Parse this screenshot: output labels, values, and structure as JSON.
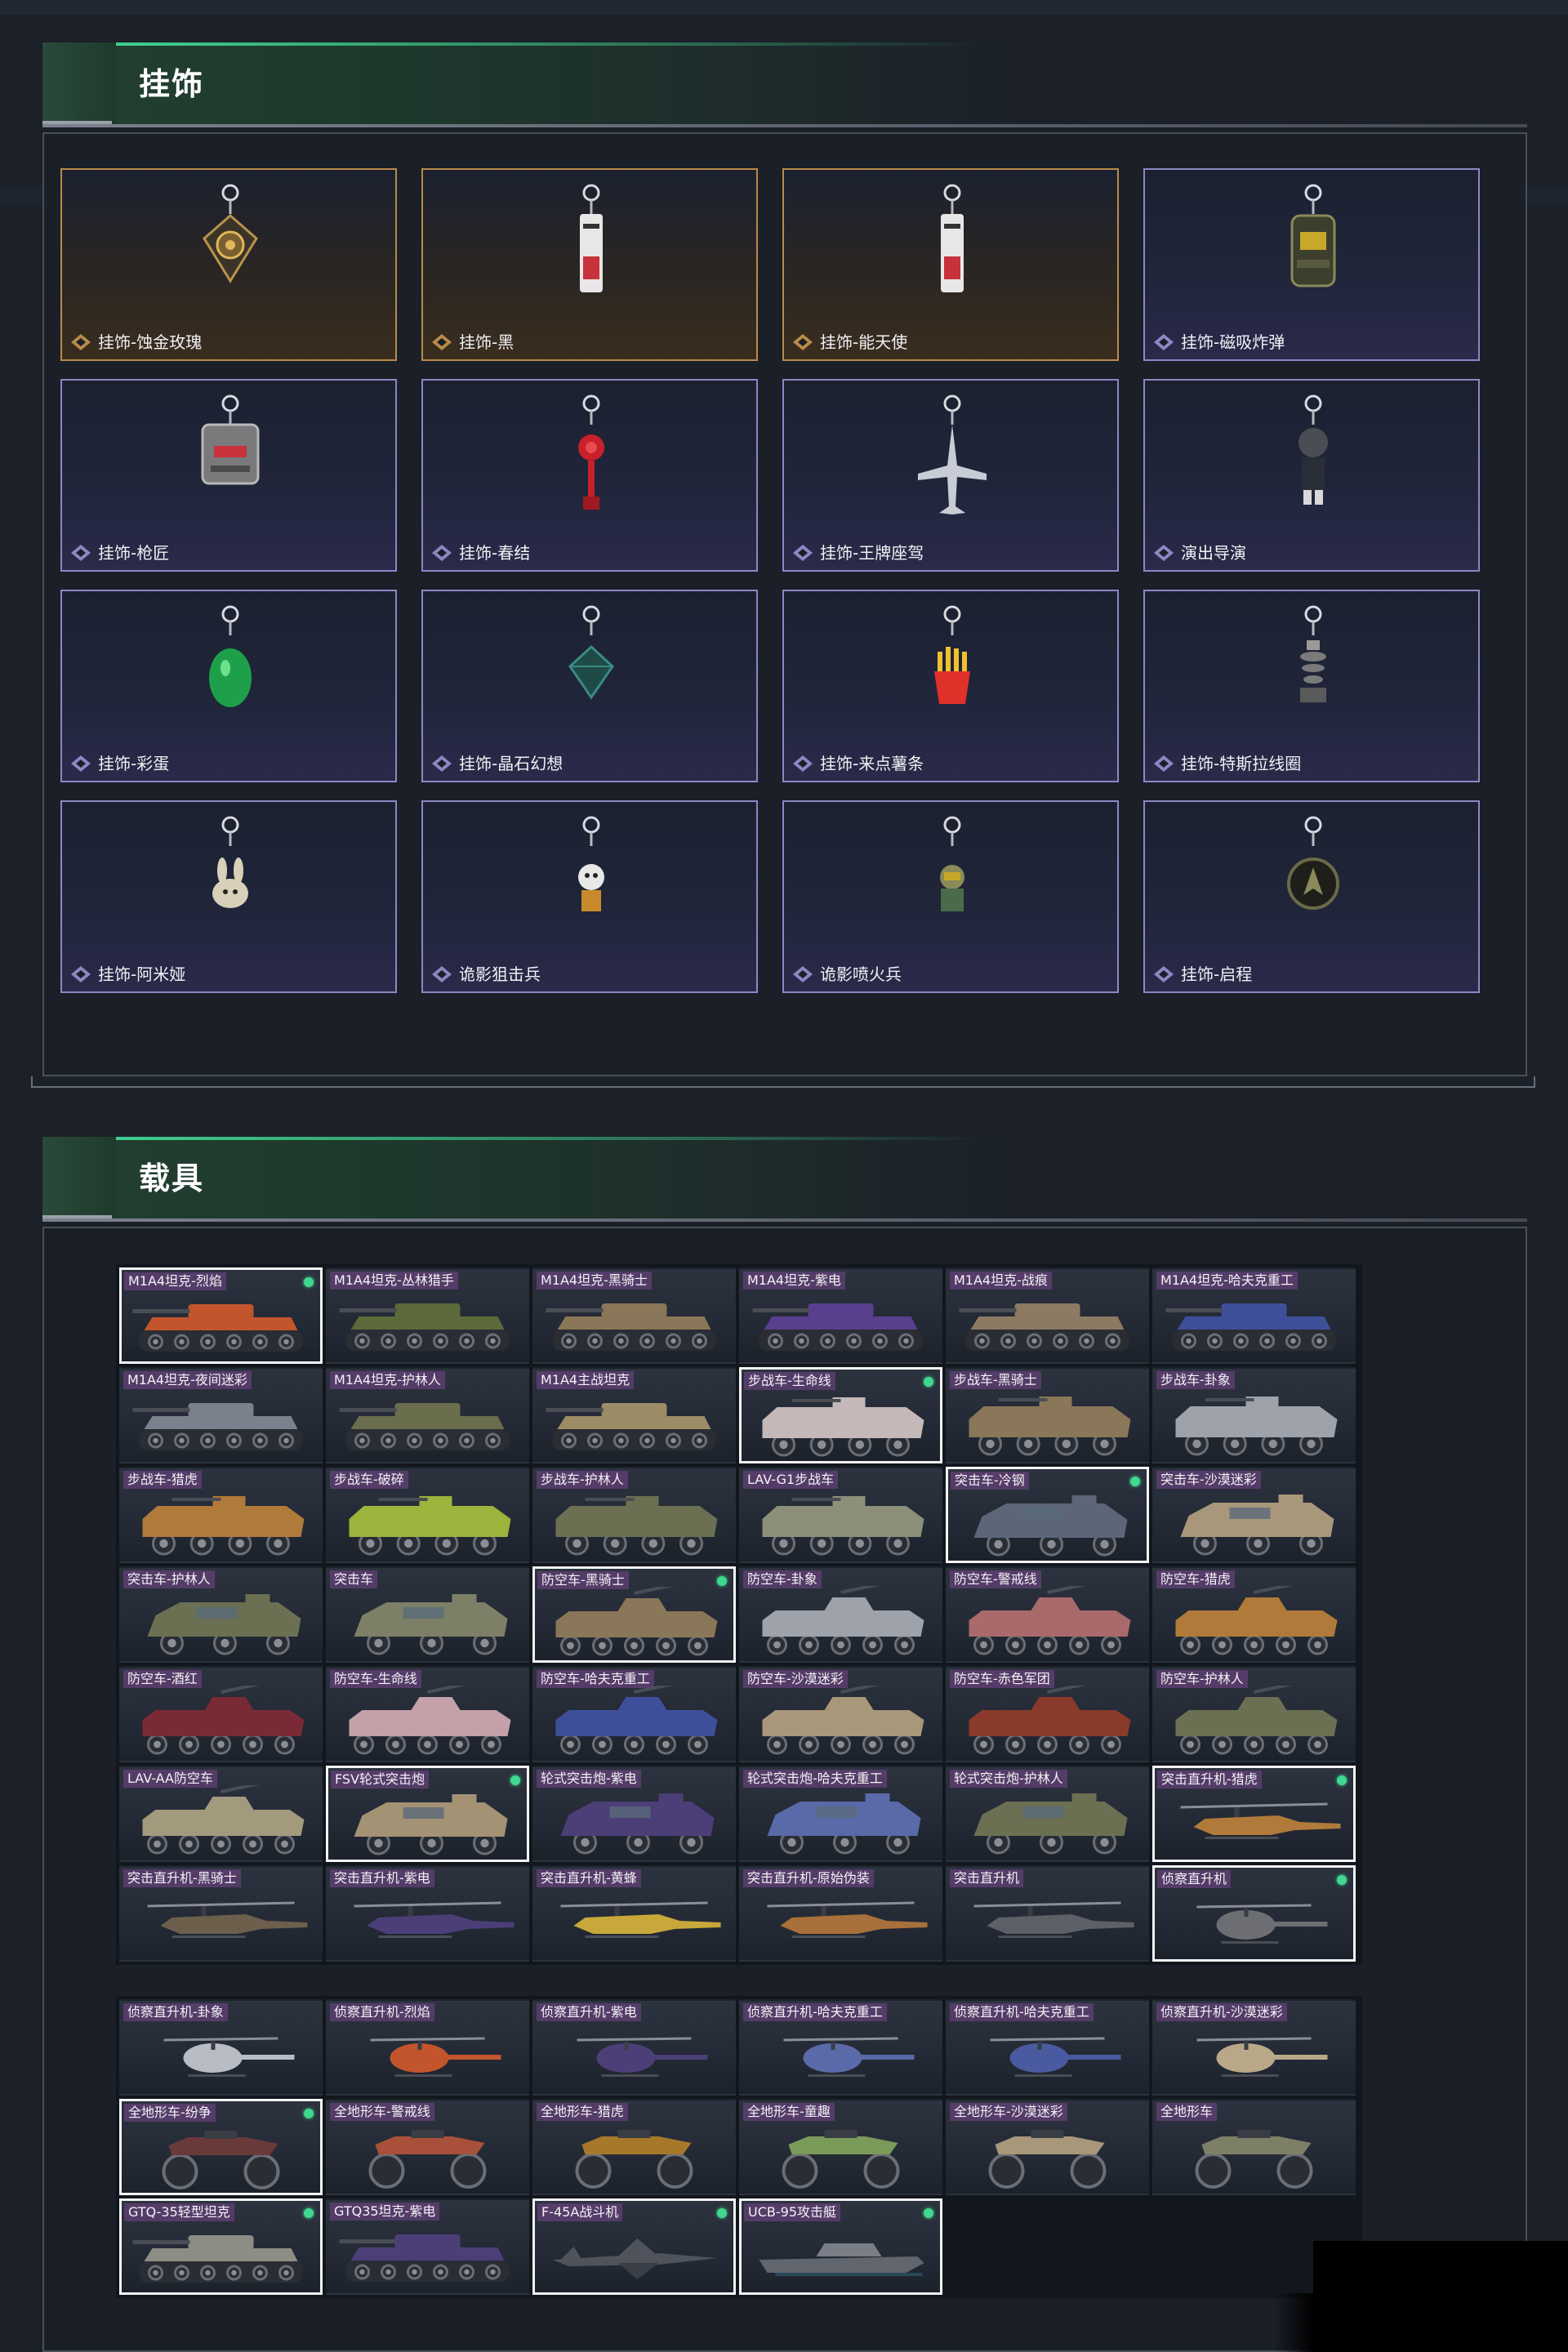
{
  "colors": {
    "accent_green": "#3fd88e",
    "purple_rarity": "#8e86c4",
    "gold_rarity": "#b98a4a",
    "page_bg": "#1b2029"
  },
  "charms_section": {
    "title": "挂饰",
    "items": [
      {
        "label": "挂饰-蚀金玫瑰",
        "rarity": "gold",
        "art": "rose"
      },
      {
        "label": "挂饰-黑",
        "rarity": "gold",
        "art": "tag"
      },
      {
        "label": "挂饰-能天使",
        "rarity": "gold",
        "art": "tag"
      },
      {
        "label": "挂饰-磁吸炸弹",
        "rarity": "purple",
        "art": "bomb"
      },
      {
        "label": "挂饰-枪匠",
        "rarity": "purple",
        "art": "pack"
      },
      {
        "label": "挂饰-春结",
        "rarity": "purple",
        "art": "knot"
      },
      {
        "label": "挂饰-王牌座驾",
        "rarity": "purple",
        "art": "jet"
      },
      {
        "label": "演出导演",
        "rarity": "purple",
        "art": "figure"
      },
      {
        "label": "挂饰-彩蛋",
        "rarity": "purple",
        "art": "egg"
      },
      {
        "label": "挂饰-晶石幻想",
        "rarity": "purple",
        "art": "crystal"
      },
      {
        "label": "挂饰-来点薯条",
        "rarity": "purple",
        "art": "fries"
      },
      {
        "label": "挂饰-特斯拉线圈",
        "rarity": "purple",
        "art": "coil"
      },
      {
        "label": "挂饰-阿米娅",
        "rarity": "purple",
        "art": "bunny"
      },
      {
        "label": "诡影狙击兵",
        "rarity": "purple",
        "art": "mini"
      },
      {
        "label": "诡影喷火兵",
        "rarity": "purple",
        "art": "mini2"
      },
      {
        "label": "挂饰-启程",
        "rarity": "purple",
        "art": "medal"
      }
    ]
  },
  "vehicles_section": {
    "title": "载具",
    "grid_a": [
      {
        "label": "M1A4坦克-烈焰",
        "type": "tank",
        "color": "#c2552b",
        "selected": true,
        "owned": true
      },
      {
        "label": "M1A4坦克-丛林猎手",
        "type": "tank",
        "color": "#5c6a3a",
        "selected": false,
        "owned": false
      },
      {
        "label": "M1A4坦克-黑骑士",
        "type": "tank",
        "color": "#8a7658",
        "selected": false,
        "owned": false
      },
      {
        "label": "M1A4坦克-紫电",
        "type": "tank",
        "color": "#5a3f8e",
        "selected": false,
        "owned": false
      },
      {
        "label": "M1A4坦克-战痕",
        "type": "tank",
        "color": "#8c7a62",
        "selected": false,
        "owned": false
      },
      {
        "label": "M1A4坦克-哈夫克重工",
        "type": "tank",
        "color": "#3e4f9a",
        "selected": false,
        "owned": false
      },
      {
        "label": "M1A4坦克-夜间迷彩",
        "type": "tank",
        "color": "#7a808c",
        "selected": false,
        "owned": false
      },
      {
        "label": "M1A4坦克-护林人",
        "type": "tank",
        "color": "#6b6e4c",
        "selected": false,
        "owned": false
      },
      {
        "label": "M1A4主战坦克",
        "type": "tank",
        "color": "#9c8c66",
        "selected": false,
        "owned": false
      },
      {
        "label": "步战车-生命线",
        "type": "ifv",
        "color": "#c4b8b8",
        "selected": true,
        "owned": true
      },
      {
        "label": "步战车-黑骑士",
        "type": "ifv",
        "color": "#8a7658",
        "selected": false,
        "owned": false
      },
      {
        "label": "步战车-卦象",
        "type": "ifv",
        "color": "#9ea3ab",
        "selected": false,
        "owned": false
      },
      {
        "label": "步战车-猎虎",
        "type": "ifv",
        "color": "#b07a3a",
        "selected": false,
        "owned": false
      },
      {
        "label": "步战车-破碎",
        "type": "ifv",
        "color": "#9cb33c",
        "selected": false,
        "owned": false
      },
      {
        "label": "步战车-护林人",
        "type": "ifv",
        "color": "#6b7052",
        "selected": false,
        "owned": false
      },
      {
        "label": "LAV-G1步战车",
        "type": "ifv",
        "color": "#8c907a",
        "selected": false,
        "owned": false
      },
      {
        "label": "突击车-冷钢",
        "type": "truck",
        "color": "#5c6678",
        "selected": true,
        "owned": true
      },
      {
        "label": "突击车-沙漠迷彩",
        "type": "truck",
        "color": "#a8977a",
        "selected": false,
        "owned": false
      },
      {
        "label": "突击车-护林人",
        "type": "truck",
        "color": "#6b7052",
        "selected": false,
        "owned": false
      },
      {
        "label": "突击车",
        "type": "truck",
        "color": "#7d8066",
        "selected": false,
        "owned": false
      },
      {
        "label": "防空车-黑骑士",
        "type": "aa",
        "color": "#8a7658",
        "selected": true,
        "owned": true
      },
      {
        "label": "防空车-卦象",
        "type": "aa",
        "color": "#9ea3ab",
        "selected": false,
        "owned": false
      },
      {
        "label": "防空车-警戒线",
        "type": "aa",
        "color": "#a86a6a",
        "selected": false,
        "owned": false
      },
      {
        "label": "防空车-猎虎",
        "type": "aa",
        "color": "#b07a3a",
        "selected": false,
        "owned": false
      },
      {
        "label": "防空车-酒红",
        "type": "aa",
        "color": "#7a2a35",
        "selected": false,
        "owned": false
      },
      {
        "label": "防空车-生命线",
        "type": "aa",
        "color": "#c4a0a8",
        "selected": false,
        "owned": false
      },
      {
        "label": "防空车-哈夫克重工",
        "type": "aa",
        "color": "#3e4f9a",
        "selected": false,
        "owned": false
      },
      {
        "label": "防空车-沙漠迷彩",
        "type": "aa",
        "color": "#a8977a",
        "selected": false,
        "owned": false
      },
      {
        "label": "防空车-赤色军团",
        "type": "aa",
        "color": "#8a3a2a",
        "selected": false,
        "owned": false
      },
      {
        "label": "防空车-护林人",
        "type": "aa",
        "color": "#6b7052",
        "selected": false,
        "owned": false
      },
      {
        "label": "LAV-AA防空车",
        "type": "aa",
        "color": "#a39a7e",
        "selected": false,
        "owned": false
      },
      {
        "label": "FSV轮式突击炮",
        "type": "truck",
        "color": "#a39274",
        "selected": true,
        "owned": true
      },
      {
        "label": "轮式突击炮-紫电",
        "type": "truck",
        "color": "#4c3f78",
        "selected": false,
        "owned": false
      },
      {
        "label": "轮式突击炮-哈夫克重工",
        "type": "truck",
        "color": "#5a6aa8",
        "selected": false,
        "owned": false
      },
      {
        "label": "轮式突击炮-护林人",
        "type": "truck",
        "color": "#6b7052",
        "selected": false,
        "owned": false
      },
      {
        "label": "突击直升机-猎虎",
        "type": "heli",
        "color": "#b07a3a",
        "selected": true,
        "owned": true
      },
      {
        "label": "突击直升机-黑骑士",
        "type": "heli",
        "color": "#6c604c",
        "selected": false,
        "owned": false
      },
      {
        "label": "突击直升机-紫电",
        "type": "heli",
        "color": "#4c3f78",
        "selected": false,
        "owned": false
      },
      {
        "label": "突击直升机-黄蜂",
        "type": "heli",
        "color": "#c8a83a",
        "selected": false,
        "owned": false
      },
      {
        "label": "突击直升机-原始伪装",
        "type": "heli",
        "color": "#a8703a",
        "selected": false,
        "owned": false
      },
      {
        "label": "突击直升机",
        "type": "heli",
        "color": "#5e6068",
        "selected": false,
        "owned": false
      },
      {
        "label": "侦察直升机",
        "type": "scout",
        "color": "#6c6e74",
        "selected": true,
        "owned": true
      }
    ],
    "grid_b": [
      {
        "label": "侦察直升机-卦象",
        "type": "scout",
        "color": "#b8bcc4",
        "selected": false,
        "owned": false
      },
      {
        "label": "侦察直升机-烈焰",
        "type": "scout",
        "color": "#c2552b",
        "selected": false,
        "owned": false
      },
      {
        "label": "侦察直升机-紫电",
        "type": "scout",
        "color": "#4c3f78",
        "selected": false,
        "owned": false
      },
      {
        "label": "侦察直升机-哈夫克重工",
        "type": "scout",
        "color": "#5a6aa8",
        "selected": false,
        "owned": false
      },
      {
        "label": "侦察直升机-哈夫克重工",
        "type": "scout",
        "color": "#4a5aa0",
        "selected": false,
        "owned": false
      },
      {
        "label": "侦察直升机-沙漠迷彩",
        "type": "scout",
        "color": "#b8a888",
        "selected": false,
        "owned": false
      },
      {
        "label": "全地形车-纷争",
        "type": "atv",
        "color": "#6a3a3a",
        "selected": true,
        "owned": true
      },
      {
        "label": "全地形车-警戒线",
        "type": "atv",
        "color": "#a8503a",
        "selected": false,
        "owned": false
      },
      {
        "label": "全地形车-猎虎",
        "type": "atv",
        "color": "#a8782a",
        "selected": false,
        "owned": false
      },
      {
        "label": "全地形车-童趣",
        "type": "atv",
        "color": "#7a9a5a",
        "selected": false,
        "owned": false
      },
      {
        "label": "全地形车-沙漠迷彩",
        "type": "atv",
        "color": "#a8977a",
        "selected": false,
        "owned": false
      },
      {
        "label": "全地形车",
        "type": "atv",
        "color": "#7d8066",
        "selected": false,
        "owned": false
      },
      {
        "label": "GTQ-35轻型坦克",
        "type": "tank",
        "color": "#8c8e86",
        "selected": true,
        "owned": true
      },
      {
        "label": "GTQ35坦克-紫电",
        "type": "tank",
        "color": "#4c3f78",
        "selected": false,
        "owned": false
      },
      {
        "label": "F-45A战斗机",
        "type": "jet",
        "color": "#4e535c",
        "selected": true,
        "owned": true
      },
      {
        "label": "UCB-95攻击艇",
        "type": "boat",
        "color": "#60656e",
        "selected": true,
        "owned": true
      }
    ]
  }
}
